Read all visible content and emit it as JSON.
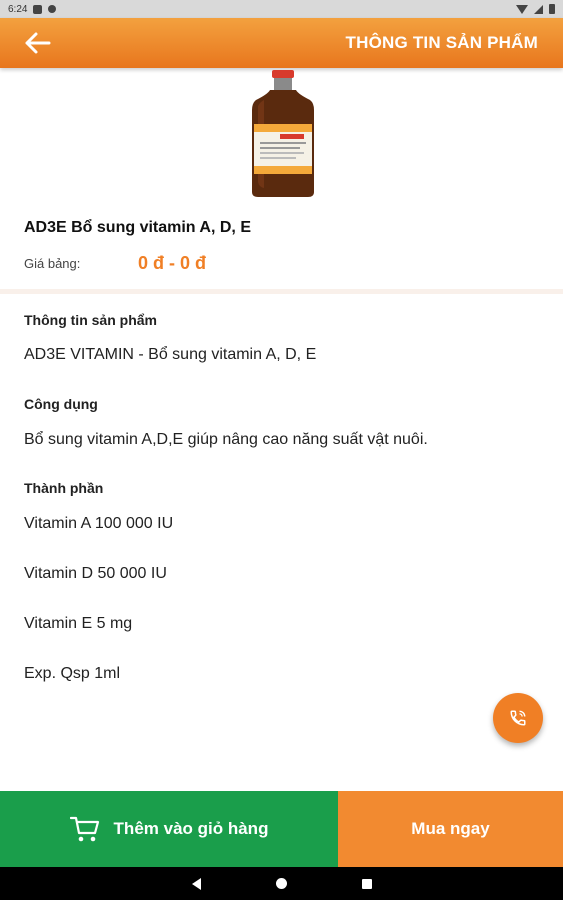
{
  "status_bar": {
    "time": "6:24"
  },
  "app_bar": {
    "title": "THÔNG TIN SẢN PHẨM",
    "back_icon": "arrow-left-icon"
  },
  "product": {
    "name": "AD3E Bổ sung vitamin A, D, E",
    "price_label": "Giá bảng:",
    "price_value": "0 đ - 0 đ",
    "image_label": "AD3E Vitamin"
  },
  "sections": {
    "info_heading": "Thông tin sản phẩm",
    "info_text": "AD3E VITAMIN - Bổ sung vitamin A, D, E",
    "usage_heading": "Công dụng",
    "usage_text": "Bổ sung vitamin A,D,E giúp nâng cao năng suất vật nuôi.",
    "ingredients_heading": "Thành phần",
    "ingredients": [
      "Vitamin A 100 000 IU",
      "Vitamin D  50 000 IU",
      "Vitamin E   5 mg",
      "Exp. Qsp  1ml"
    ]
  },
  "actions": {
    "add_to_cart": "Thêm vào giỏ hàng",
    "buy_now": "Mua ngay",
    "cart_icon": "cart-icon",
    "call_icon": "phone-icon"
  },
  "colors": {
    "accent_orange": "#f07f25",
    "cart_green": "#1a9e4b"
  }
}
